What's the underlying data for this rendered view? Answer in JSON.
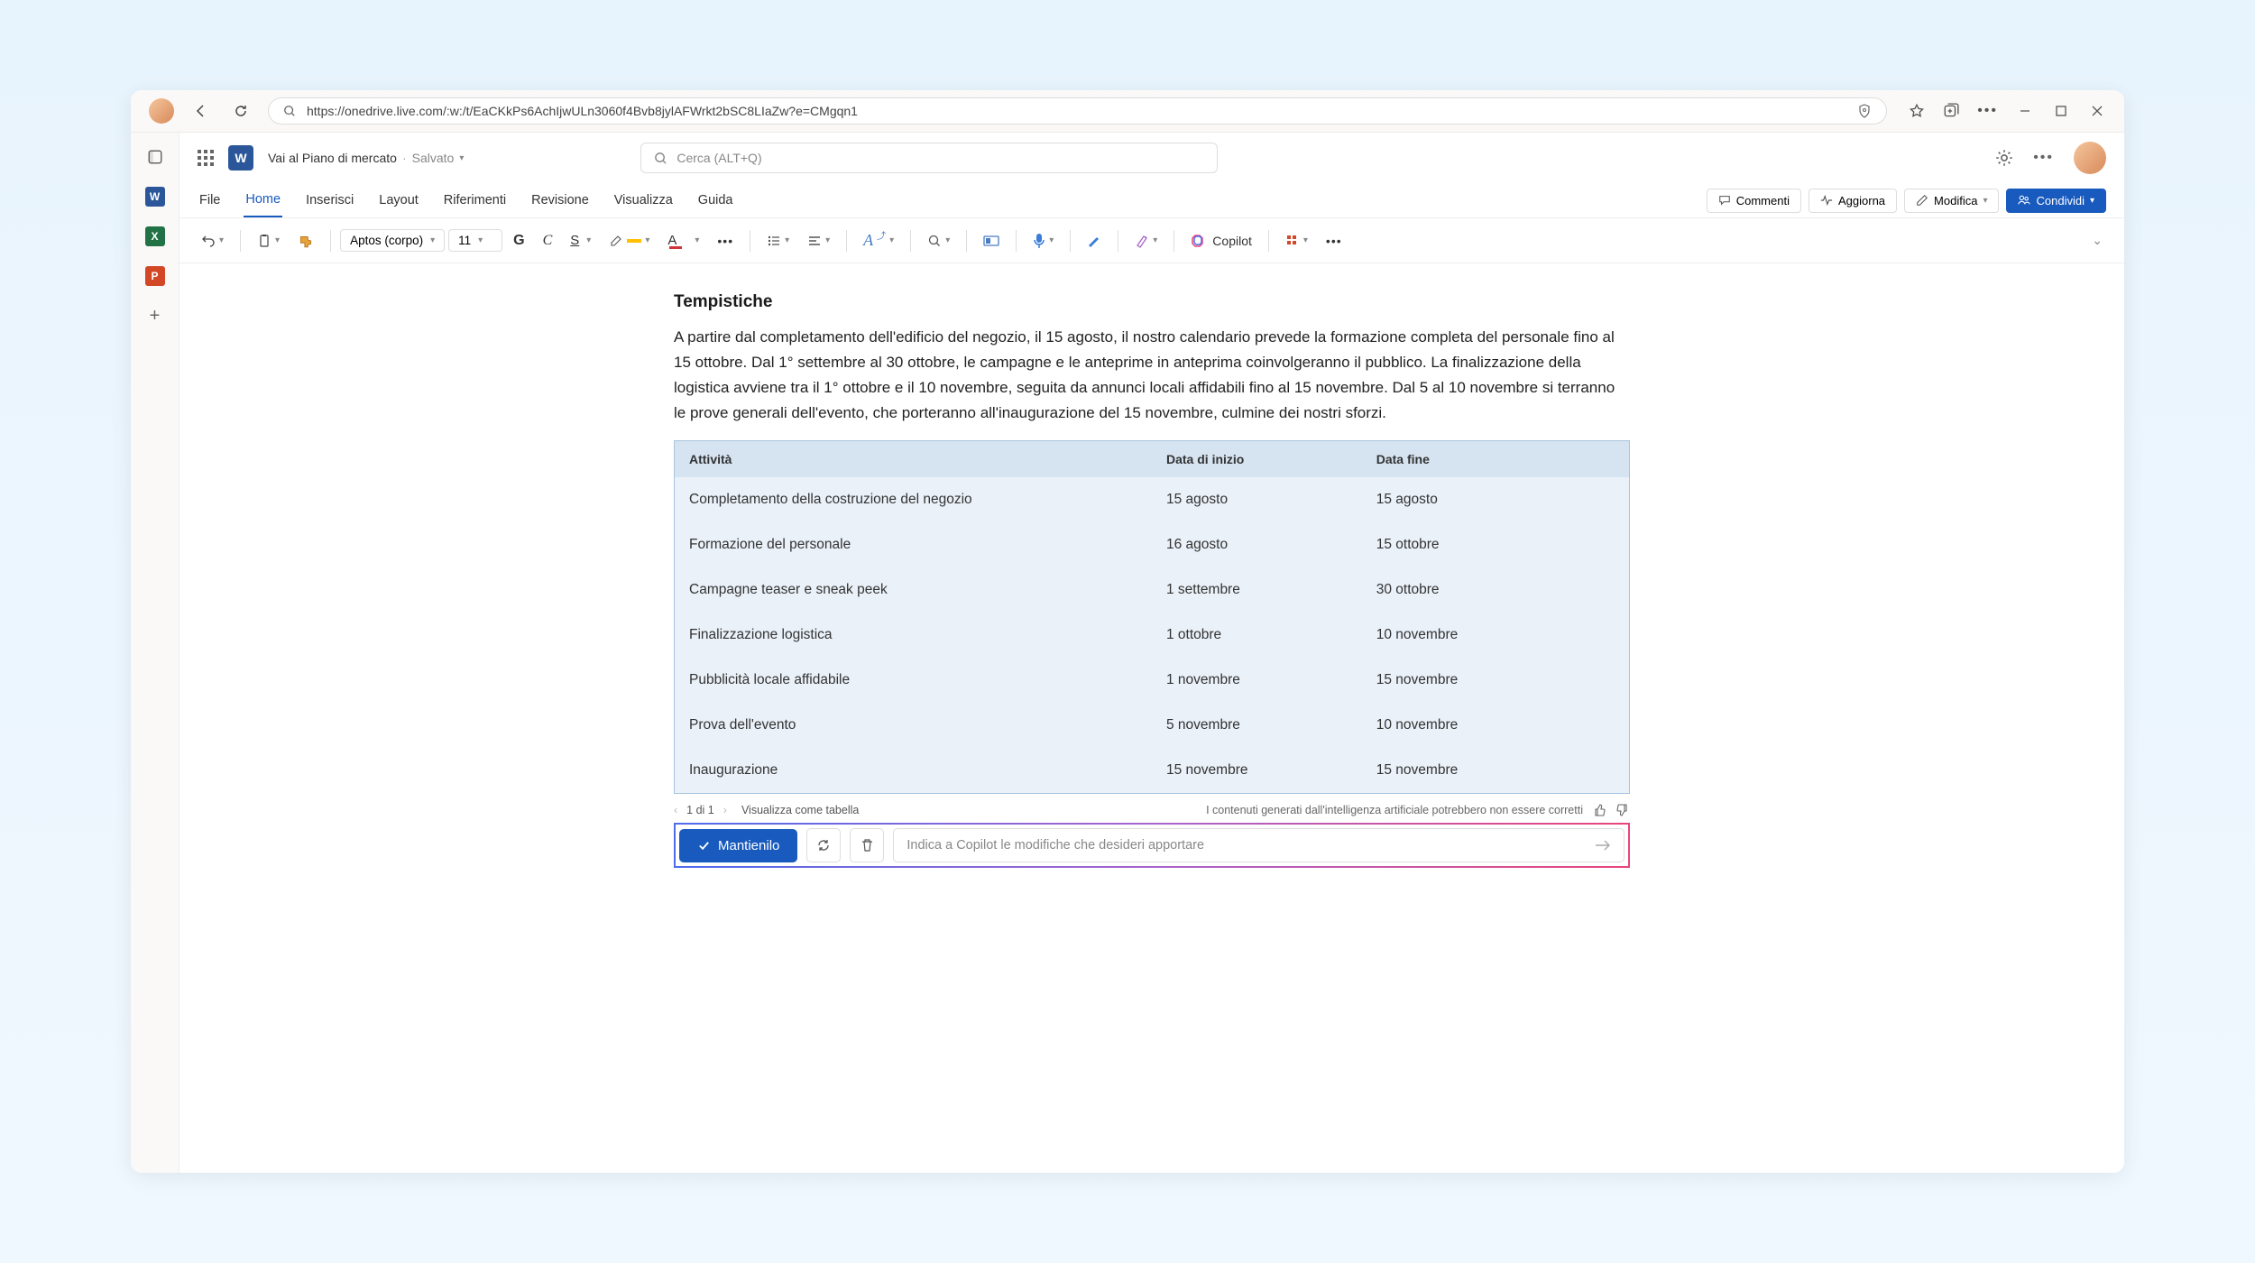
{
  "browser": {
    "url": "https://onedrive.live.com/:w:/t/EaCKkPs6AchIjwULn3060f4Bvb8jylAFWrkt2bSC8LIaZw?e=CMgqn1"
  },
  "header": {
    "doc_title": "Vai al Piano di mercato",
    "saved_label": "Salvato",
    "search_placeholder": "Cerca (ALT+Q)"
  },
  "tabs": {
    "file": "File",
    "home": "Home",
    "insert": "Inserisci",
    "layout": "Layout",
    "references": "Riferimenti",
    "review": "Revisione",
    "display": "Visualizza",
    "help": "Guida"
  },
  "ribbon_right": {
    "comments": "Commenti",
    "update": "Aggiorna",
    "edit": "Modifica",
    "share": "Condividi"
  },
  "toolbar": {
    "font_name": "Aptos (corpo)",
    "font_size": "11",
    "copilot": "Copilot"
  },
  "document": {
    "heading": "Tempistiche",
    "paragraph": "A partire dal completamento dell'edificio del negozio, il 15 agosto, il nostro calendario prevede la formazione completa del personale fino al 15 ottobre. Dal 1° settembre al 30 ottobre, le campagne e le anteprime in anteprima coinvolgeranno il pubblico. La finalizzazione della logistica avviene tra il 1° ottobre e il 10 novembre, seguita da annunci locali affidabili fino al 15 novembre. Dal 5 al 10 novembre si terranno le prove generali dell'evento, che porteranno all'inaugurazione del 15 novembre, culmine dei nostri sforzi.",
    "columns": {
      "activity": "Attività",
      "start": "Data di inizio",
      "end": "Data fine"
    },
    "rows": [
      {
        "activity": "Completamento della costruzione del negozio",
        "start": "15 agosto",
        "end": "15 agosto"
      },
      {
        "activity": "Formazione del personale",
        "start": "16 agosto",
        "end": "15 ottobre"
      },
      {
        "activity": "Campagne teaser e sneak peek",
        "start": "1 settembre",
        "end": "30 ottobre"
      },
      {
        "activity": "Finalizzazione logistica",
        "start": "1 ottobre",
        "end": "10 novembre"
      },
      {
        "activity": "Pubblicità locale affidabile",
        "start": "1 novembre",
        "end": "15 novembre"
      },
      {
        "activity": "Prova dell'evento",
        "start": "5 novembre",
        "end": "10 novembre"
      },
      {
        "activity": "Inaugurazione",
        "start": "15 novembre",
        "end": "15 novembre"
      }
    ]
  },
  "copilot": {
    "pager": "1 di 1",
    "view_as_table": "Visualizza come tabella",
    "disclaimer": "I contenuti generati dall'intelligenza artificiale potrebbero non essere corretti",
    "keep": "Mantienilo",
    "prompt_placeholder": "Indica a Copilot le modifiche che desideri apportare"
  }
}
